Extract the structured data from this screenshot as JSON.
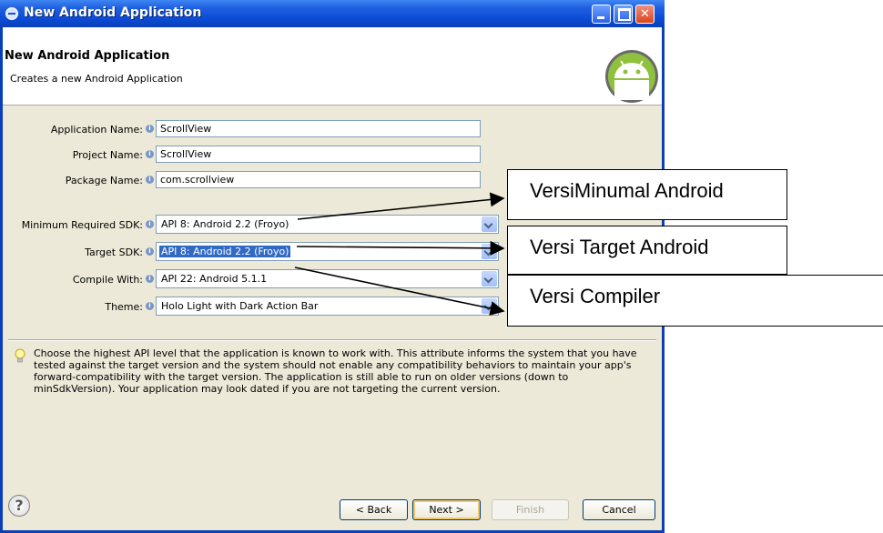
{
  "window": {
    "title": "New Android Application",
    "minimize_icon": "minimize-icon",
    "maximize_icon": "maximize-icon",
    "close_icon": "close-icon"
  },
  "header": {
    "title": "New Android Application",
    "description": "Creates a new Android Application",
    "logo_icon": "android-logo"
  },
  "fields": {
    "application_name": {
      "label": "Application Name:",
      "value": "ScrollView"
    },
    "project_name": {
      "label": "Project Name:",
      "value": "ScrollView"
    },
    "package_name": {
      "label": "Package Name:",
      "value": "com.scrollview"
    },
    "min_sdk": {
      "label": "Minimum Required SDK:",
      "value": "API 8: Android 2.2 (Froyo)"
    },
    "target_sdk": {
      "label": "Target SDK:",
      "value": "API 8: Android 2.2 (Froyo)"
    },
    "compile_with": {
      "label": "Compile With:",
      "value": "API 22: Android 5.1.1"
    },
    "theme": {
      "label": "Theme:",
      "value": "Holo Light with Dark Action Bar"
    }
  },
  "help": {
    "icon": "lightbulb-icon",
    "text": "Choose the highest API level that the application is known to work with. This attribute informs the system that you have tested against the target version and the system should not enable any compatibility behaviors to maintain your app's forward-compatibility with the target version. The application is still able to run on older versions (down to minSdkVersion). Your application may look dated if you are not targeting the current version."
  },
  "buttons": {
    "help_glyph": "?",
    "back": "< Back",
    "next": "Next >",
    "finish": "Finish",
    "cancel": "Cancel"
  },
  "annotations": {
    "min_sdk": "VersiMinumal Android",
    "target_sdk": "Versi Target Android",
    "compiler": "Versi Compiler"
  },
  "colors": {
    "titlebar": "#0a3fb5",
    "dialog_bg": "#ece9d8",
    "selection": "#316ac5",
    "android_green": "#8fc13e"
  }
}
